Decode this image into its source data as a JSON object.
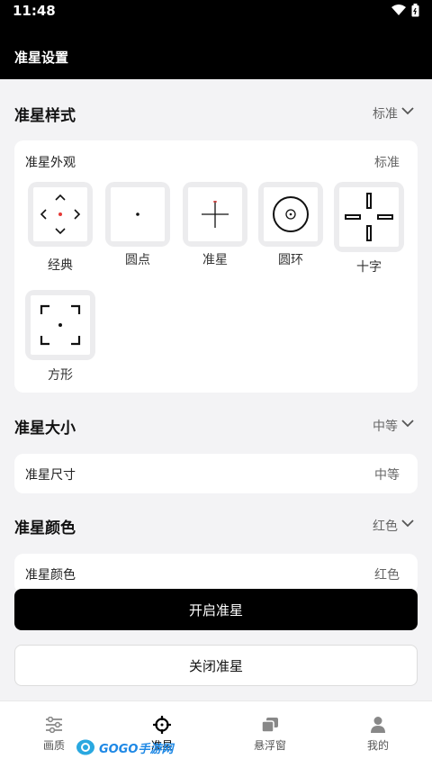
{
  "status": {
    "time": "11:48"
  },
  "header": {
    "title": "准星设置"
  },
  "style_section": {
    "title": "准星样式",
    "value": "标准",
    "card_label": "准星外观",
    "card_value": "标准",
    "items": [
      {
        "label": "经典",
        "icon": "classic-crosshair-icon"
      },
      {
        "label": "圆点",
        "icon": "dot-crosshair-icon"
      },
      {
        "label": "准星",
        "icon": "cross-crosshair-icon"
      },
      {
        "label": "圆环",
        "icon": "ring-crosshair-icon"
      },
      {
        "label": "十字",
        "icon": "plus-crosshair-icon"
      },
      {
        "label": "方形",
        "icon": "square-crosshair-icon"
      }
    ]
  },
  "size_section": {
    "title": "准星大小",
    "value": "中等",
    "card_label": "准星尺寸",
    "card_value": "中等"
  },
  "color_section": {
    "title": "准星颜色",
    "value": "红色",
    "card_label": "准星颜色",
    "card_value": "红色"
  },
  "buttons": {
    "enable": "开启准星",
    "disable": "关闭准星"
  },
  "nav": {
    "items": [
      {
        "label": "画质",
        "icon": "sliders-icon"
      },
      {
        "label": "准星",
        "icon": "crosshair-icon"
      },
      {
        "label": "悬浮窗",
        "icon": "window-icon"
      },
      {
        "label": "我的",
        "icon": "user-icon"
      }
    ]
  },
  "watermark": {
    "text": "GOGO手游网"
  },
  "colors": {
    "accent_red": "#e53935",
    "primary": "#000000"
  }
}
